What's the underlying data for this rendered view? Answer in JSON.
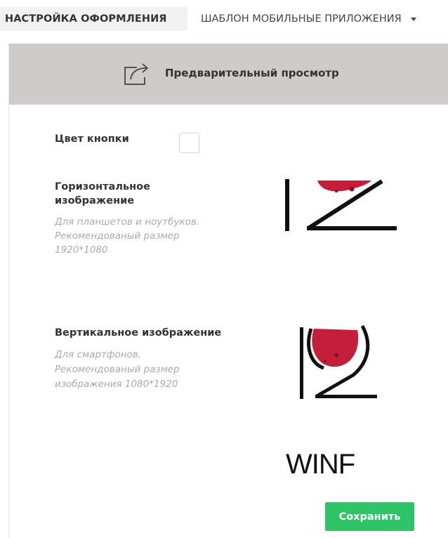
{
  "tabs": [
    {
      "label": "НАСТРОЙКА ОФОРМЛЕНИЯ",
      "active": true
    },
    {
      "label": "ШАБЛОН МОБИЛЬНЫЕ ПРИЛОЖЕНИЯ",
      "active": false
    }
  ],
  "preview": {
    "label": "Предварительный просмотр",
    "icon": "share-export-icon"
  },
  "fields": {
    "button_color": {
      "label": "Цвет кнопки"
    },
    "horizontal_image": {
      "label_line1": "Горизонтальное",
      "label_line2": "изображение",
      "hint_line1": "Для планшетов и ноутбуков.",
      "hint_line2": "Рекомендованый размер",
      "hint_line3": "1920*1080"
    },
    "vertical_image": {
      "label": "Вертикальное изображение",
      "hint_line1": "Для смартфонов.",
      "hint_line2": "Рекомендованый размер",
      "hint_line3": "изображения 1080*1920"
    }
  },
  "wine_logo_text": "WINF",
  "save_label": "Сохранить",
  "colors": {
    "preview_bar": "#cfcbca",
    "save_button": "#2ec468",
    "wine_stain": "#c41e3a",
    "active_tab": "#f2f2f2"
  }
}
